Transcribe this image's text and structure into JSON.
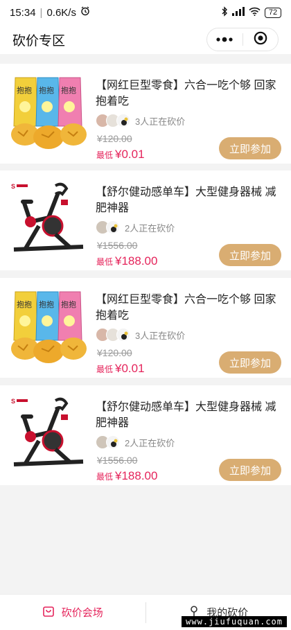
{
  "status_bar": {
    "time": "15:34",
    "net_speed": "0.6K/s",
    "battery": "72"
  },
  "header": {
    "title": "砍价专区"
  },
  "products": [
    {
      "title": "【网红巨型零食】六合一吃个够 回家抱着吃",
      "helpers_text": "3人正在砍价",
      "original_price": "¥120.00",
      "lowest_label": "最低",
      "lowest_price": "¥0.01",
      "button": "立即参加",
      "image": "snack-bags"
    },
    {
      "title": "【舒尔健动感单车】大型健身器械 减肥神器",
      "helpers_text": "2人正在砍价",
      "original_price": "¥1556.00",
      "lowest_label": "最低",
      "lowest_price": "¥188.00",
      "button": "立即参加",
      "image": "spin-bike"
    },
    {
      "title": "【网红巨型零食】六合一吃个够 回家抱着吃",
      "helpers_text": "3人正在砍价",
      "original_price": "¥120.00",
      "lowest_label": "最低",
      "lowest_price": "¥0.01",
      "button": "立即参加",
      "image": "snack-bags"
    },
    {
      "title": "【舒尔健动感单车】大型健身器械 减肥神器",
      "helpers_text": "2人正在砍价",
      "original_price": "¥1556.00",
      "lowest_label": "最低",
      "lowest_price": "¥188.00",
      "button": "立即参加",
      "image": "spin-bike"
    }
  ],
  "tabbar": {
    "tab1": "砍价会场",
    "tab2": "我的砍价"
  },
  "watermark": "www.jiufuquan.com",
  "colors": {
    "accent": "#e5245b",
    "button": "#d9ad72"
  }
}
